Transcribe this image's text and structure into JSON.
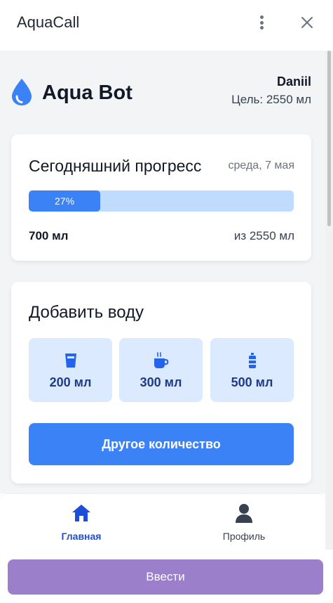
{
  "window": {
    "title": "AquaCall",
    "menu_icon": "kebab-menu-icon",
    "close_icon": "close-icon"
  },
  "header": {
    "icon": "water-drop-icon",
    "bot_name": "Aqua Bot",
    "user_name": "Daniil",
    "goal": "Цель: 2550 мл"
  },
  "progress": {
    "title": "Сегодняшний прогресс",
    "date": "среда, 7 мая",
    "percent_label": "27%",
    "fraction": 0.27,
    "current": "700 мл",
    "total": "из 2550 мл"
  },
  "add_water": {
    "title": "Добавить воду",
    "options": [
      {
        "label": "200 мл",
        "icon": "glass-icon"
      },
      {
        "label": "300 мл",
        "icon": "mug-icon"
      },
      {
        "label": "500 мл",
        "icon": "bottle-icon"
      }
    ],
    "other_label": "Другое количество"
  },
  "nav": {
    "home_label": "Главная",
    "home_icon": "home-icon",
    "profile_label": "Профиль",
    "profile_icon": "user-icon"
  },
  "enter_button": "Ввести",
  "colors": {
    "accent": "#3b82f6",
    "accent_light": "#dbeafe",
    "nav_active": "#1d4ed8",
    "enter_button": "#9b7fcb"
  }
}
